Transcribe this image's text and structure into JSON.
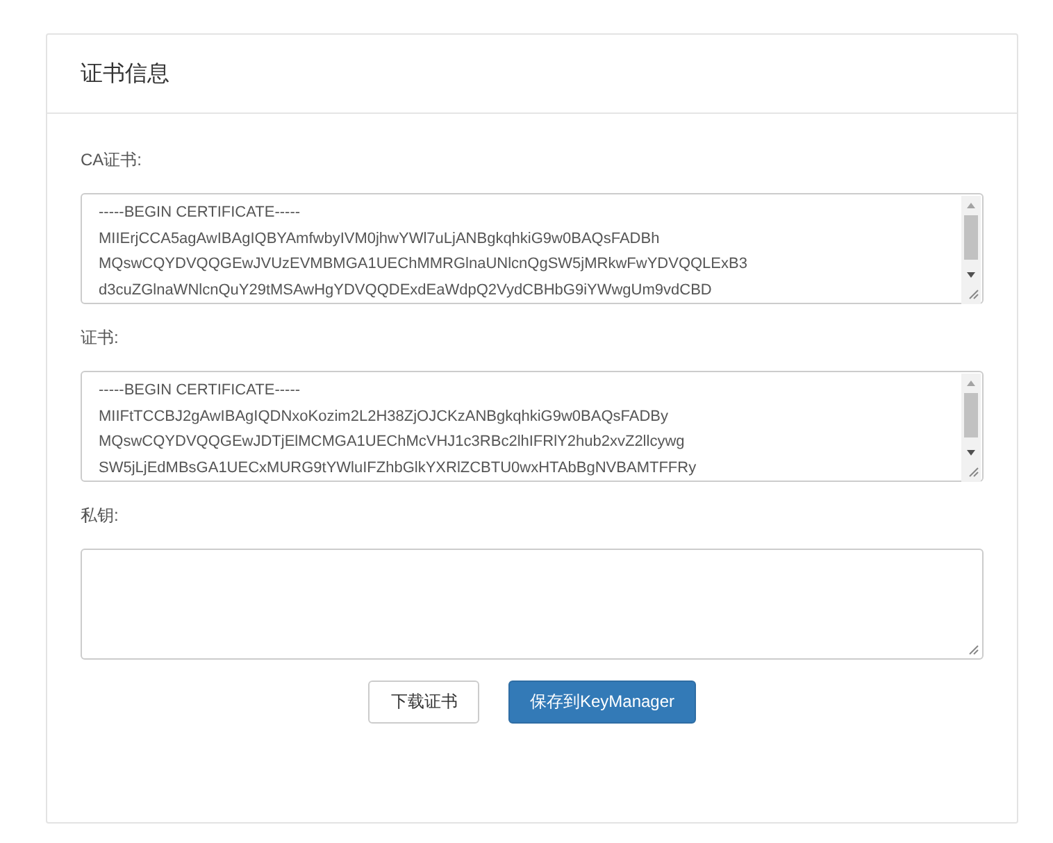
{
  "panel": {
    "title": "证书信息"
  },
  "fields": [
    {
      "label": "CA证书:",
      "lines": [
        "-----BEGIN CERTIFICATE-----",
        "MIIErjCCA5agAwIBAgIQBYAmfwbyIVM0jhwYWl7uLjANBgkqhkiG9w0BAQsFADBh",
        "MQswCQYDVQQGEwJVUzEVMBMGA1UEChMMRGlnaUNlcnQgSW5jMRkwFwYDVQQLExB3",
        "d3cuZGlnaWNlcnQuY29tMSAwHgYDVQQDExdEaWdpQ2VydCBHbG9iYWwgUm9vdCBD"
      ],
      "scrollbar": true
    },
    {
      "label": "证书:",
      "lines": [
        "-----BEGIN CERTIFICATE-----",
        "MIIFtTCCBJ2gAwIBAgIQDNxoKozim2L2H38ZjOJCKzANBgkqhkiG9w0BAQsFADBy",
        "MQswCQYDVQQGEwJDTjElMCMGA1UEChMcVHJ1c3RBc2lhIFRlY2hub2xvZ2llcywg",
        "SW5jLjEdMBsGA1UECxMURG9tYWluIFZhbGlkYXRlZCBTU0wxHTAbBgNVBAMTFFRy"
      ],
      "scrollbar": true
    },
    {
      "label": "私钥:",
      "scrollbar": false
    }
  ],
  "buttons": [
    {
      "label": "下载证书",
      "kind": "default"
    },
    {
      "label": "保存到KeyManager",
      "kind": "primary"
    }
  ]
}
